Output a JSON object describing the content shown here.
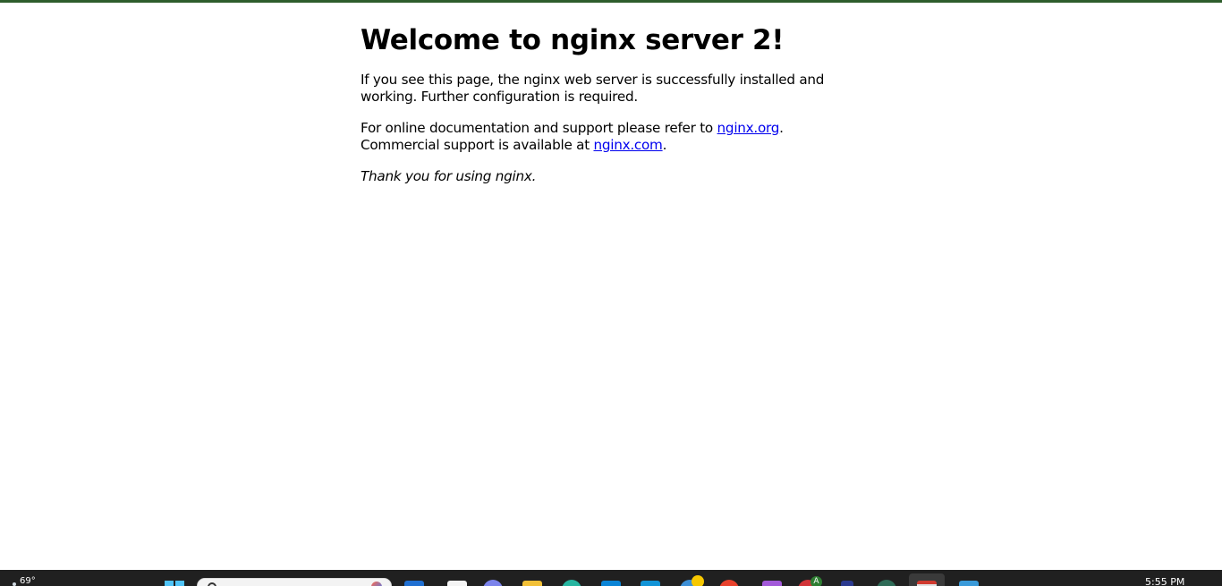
{
  "page": {
    "heading": "Welcome to nginx server 2!",
    "para1": "If you see this page, the nginx web server is successfully installed and working. Further configuration is required.",
    "para2_prefix": "For online documentation and support please refer to ",
    "link_org": "nginx.org",
    "para2_mid": ". Commercial support is available at ",
    "link_com": "nginx.com",
    "para2_suffix": ".",
    "thanks": "Thank you for using nginx."
  },
  "taskbar": {
    "weather_temp": "69°",
    "clock_time": "5:55 PM",
    "badge_letter": "A",
    "apps": [
      "windows-start-icon",
      "search-icon",
      "edge-icon",
      "notepad-icon",
      "teams-icon",
      "file-explorer-icon",
      "app-icon",
      "store-icon",
      "app-icon",
      "chrome-icon",
      "office-icon",
      "onenote-icon",
      "app-icon",
      "app-icon",
      "app-icon",
      "calendar-icon",
      "app-icon"
    ],
    "accent_color": "#2e5d2c"
  }
}
